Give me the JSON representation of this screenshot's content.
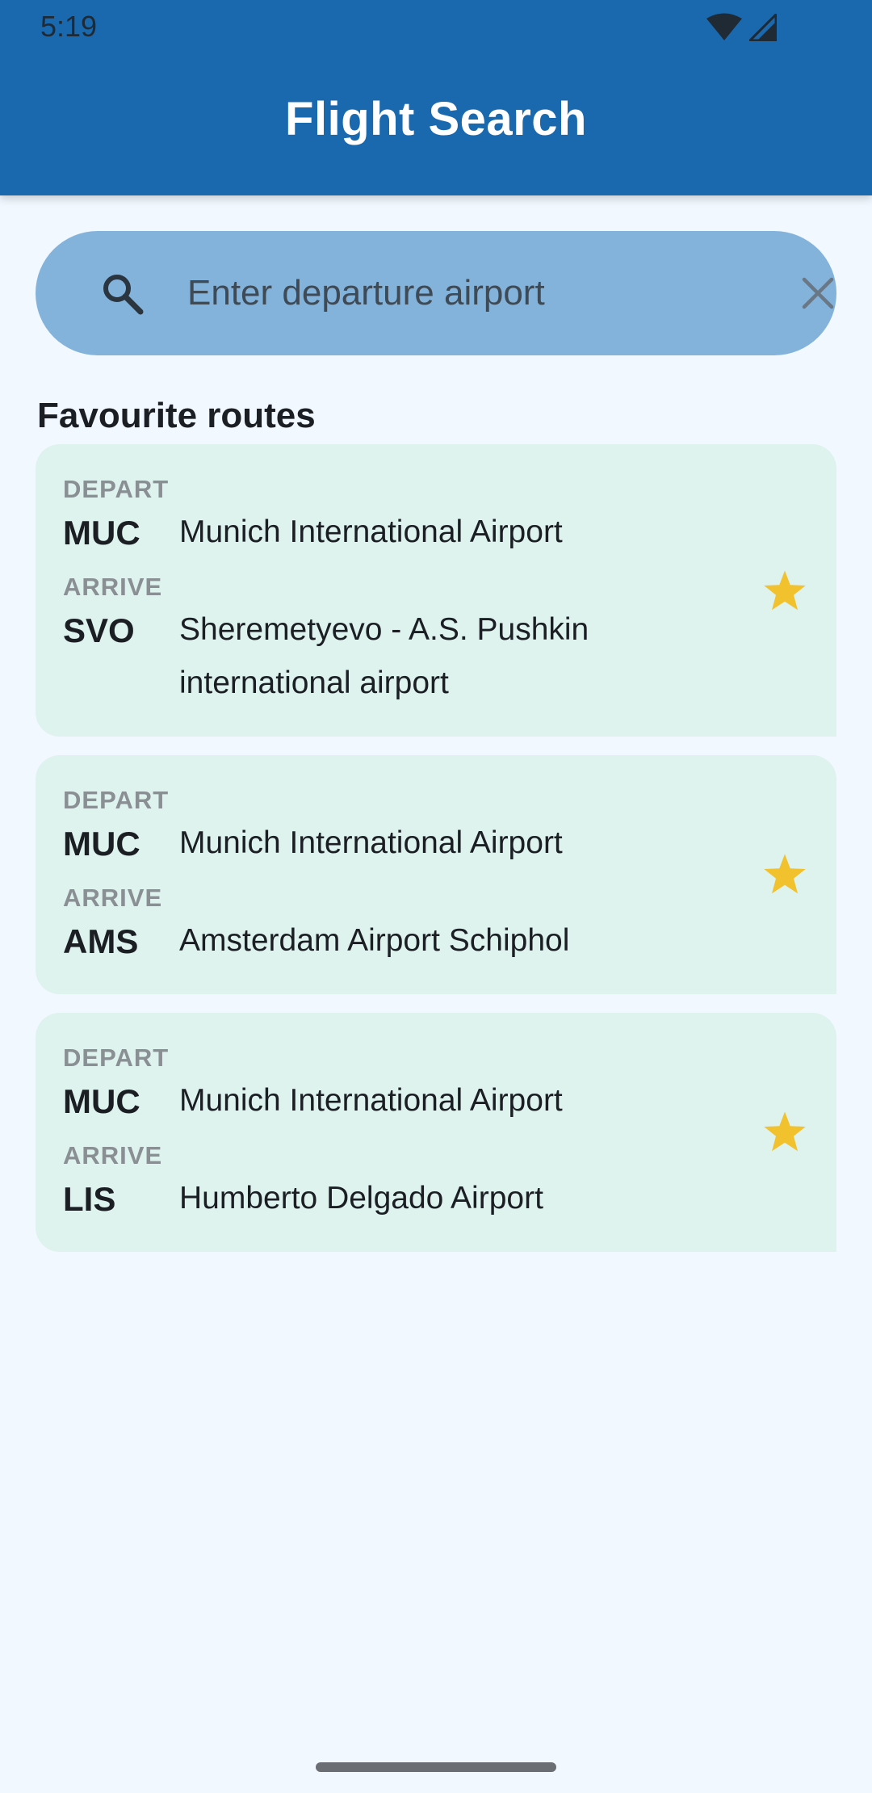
{
  "status_bar": {
    "time": "5:19"
  },
  "app_bar": {
    "title": "Flight Search",
    "color": "#1A69AF"
  },
  "search": {
    "placeholder": "Enter departure airport",
    "value": "",
    "icons": [
      "search-icon",
      "close-icon"
    ]
  },
  "favourites": {
    "title": "Favourite routes",
    "routes": [
      {
        "depart_label": "DEPART",
        "depart_code": "MUC",
        "depart_name": "Munich International Airport",
        "arrive_label": "ARRIVE",
        "arrive_code": "SVO",
        "arrive_name": "Sheremetyevo - A.S. Pushkin international airport",
        "favourite": true
      },
      {
        "depart_label": "DEPART",
        "depart_code": "MUC",
        "depart_name": "Munich International Airport",
        "arrive_label": "ARRIVE",
        "arrive_code": "AMS",
        "arrive_name": "Amsterdam Airport Schiphol",
        "favourite": true
      },
      {
        "depart_label": "DEPART",
        "depart_code": "MUC",
        "depart_name": "Munich International Airport",
        "arrive_label": "ARRIVE",
        "arrive_code": "LIS",
        "arrive_name": "Humberto Delgado Airport",
        "favourite": true
      }
    ]
  },
  "colors": {
    "background": "#F1F8FF",
    "search_bar": "#83B3DB",
    "card": "#DEF2EE",
    "star": "#F2C12E"
  }
}
